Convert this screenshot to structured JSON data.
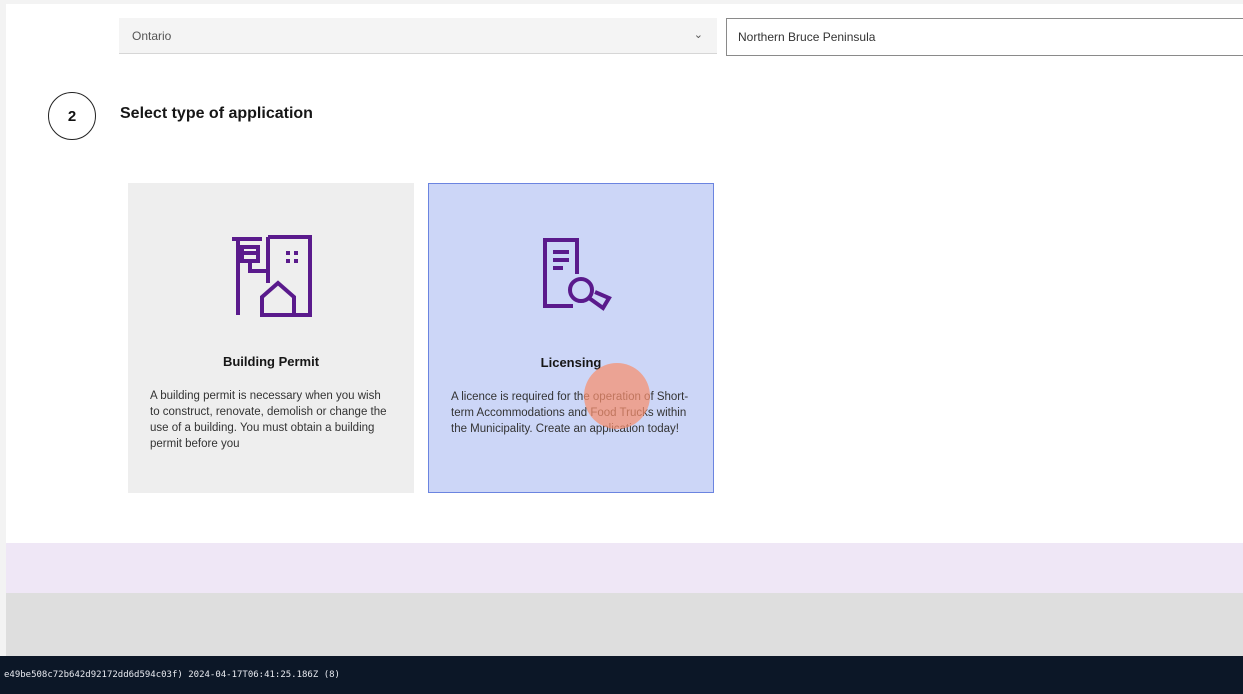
{
  "location": {
    "province": "Ontario",
    "municipality": "Northern Bruce Peninsula"
  },
  "step": {
    "number": "2",
    "title": "Select type of application"
  },
  "cards": [
    {
      "title": "Building Permit",
      "description": "A building permit is necessary when you wish to construct, renovate, demolish or change the use of a building. You must obtain a building permit before you",
      "icon": "building-permit-icon",
      "selected": false
    },
    {
      "title": "Licensing",
      "description": "A licence is required for the operation of Short-term Accommodations and Food Trucks within the Municipality. Create an application today!",
      "icon": "license-certificate-icon",
      "selected": true
    }
  ],
  "status_bar": {
    "text": "e49be508c72b642d92172dd6d594c03f) 2024-04-17T06:41:25.186Z (8)"
  },
  "colors": {
    "accent_purple": "#5a1a8c",
    "selected_card_bg": "#ccd6f7",
    "selected_card_border": "#6b84e0",
    "status_bar_bg": "#0c1727"
  }
}
